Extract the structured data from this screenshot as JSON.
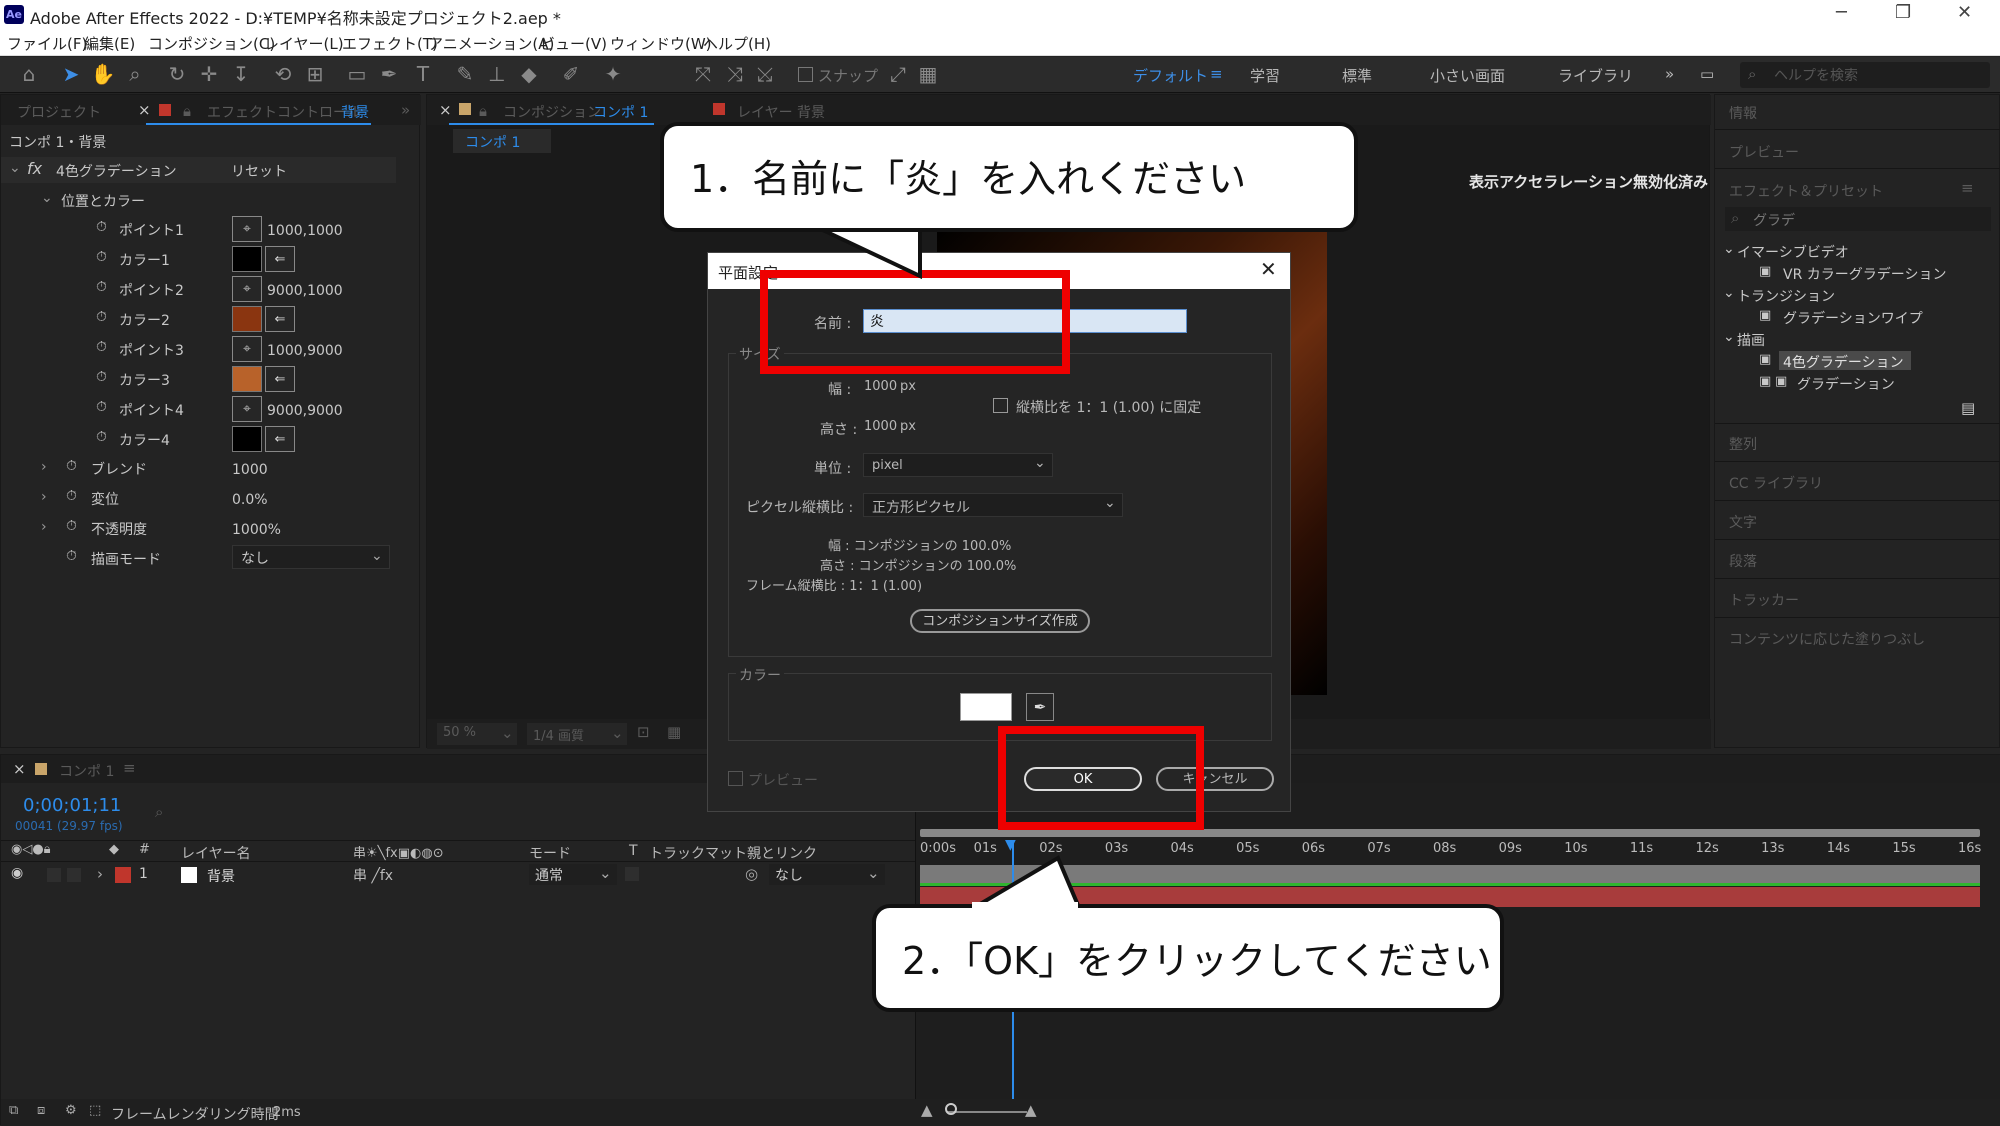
{
  "window": {
    "title": "Adobe After Effects 2022 - D:¥TEMP¥名称未設定プロジェクト2.aep *",
    "app_icon": "Ae"
  },
  "menu": [
    "ファイル(F)",
    "編集(E)",
    "コンポジション(C)",
    "レイヤー(L)",
    "エフェクト(T)",
    "アニメーション(A)",
    "ビュー(V)",
    "ウィンドウ(W)",
    "ヘルプ(H)"
  ],
  "toolbar": {
    "snap_label": "スナップ",
    "workspaces": [
      "デフォルト",
      "学習",
      "標準",
      "小さい画面",
      "ライブラリ"
    ],
    "help_search_placeholder": "ヘルプを検索"
  },
  "effects_panel": {
    "tab_project": "プロジェクト",
    "tab_effect_controls": "エフェクトコントロール",
    "tab_layer": "背景",
    "breadcrumb": "コンポ 1・背景",
    "effect_name": "4色グラデーション",
    "reset_label": "リセット",
    "group_label": "位置とカラー",
    "props": [
      {
        "label": "ポイント1",
        "value": "1000,1000"
      },
      {
        "label": "カラー1",
        "color": "#000000"
      },
      {
        "label": "ポイント2",
        "value": "9000,1000"
      },
      {
        "label": "カラー2",
        "color": "#8a3510"
      },
      {
        "label": "ポイント3",
        "value": "1000,9000"
      },
      {
        "label": "カラー3",
        "color": "#b8622a"
      },
      {
        "label": "ポイント4",
        "value": "9000,9000"
      },
      {
        "label": "カラー4",
        "color": "#000000"
      }
    ],
    "blend_label": "ブレンド",
    "blend_value": "1000",
    "jitter_label": "変位",
    "jitter_value": "0.0%",
    "opacity_label": "不透明度",
    "opacity_value": "1000%",
    "mode_label": "描画モード",
    "mode_value": "なし"
  },
  "comp_panel": {
    "tab_comp_prefix": "コンポジション",
    "tab_comp_name": "コンポ 1",
    "tab_layer": "レイヤー 背景",
    "sub_tab": "コンポ 1",
    "accel_notice": "表示アクセラレーション無効化済み",
    "zoom": "50 %",
    "resolution": "1/4 画質"
  },
  "right_panel": {
    "sections": [
      "情報",
      "プレビュー",
      "エフェクト＆プリセット"
    ],
    "search_value": "グラデ",
    "tree": [
      {
        "group": "イマーシブビデオ",
        "items": [
          "VR カラーグラデーション"
        ]
      },
      {
        "group": "トランジション",
        "items": [
          "グラデーションワイプ"
        ]
      },
      {
        "group": "描画",
        "items": [
          "4色グラデーション",
          "グラデーション"
        ]
      }
    ],
    "lower_sections": [
      "整列",
      "CC ライブラリ",
      "文字",
      "段落",
      "トラッカー",
      "コンテンツに応じた塗りつぶし"
    ]
  },
  "timeline": {
    "tab_name": "コンポ 1",
    "timecode": "0;00;01;11",
    "frames": "00041 (29.97 fps)",
    "columns": [
      "レイヤー名",
      "モード",
      "T",
      "トラックマット",
      "親とリンク"
    ],
    "layer": {
      "index": "1",
      "name": "背景",
      "mode": "通常",
      "parent": "なし"
    },
    "ruler": [
      "0:00s",
      "01s",
      "02s",
      "03s",
      "04s",
      "05s",
      "06s",
      "07s",
      "08s",
      "09s",
      "10s",
      "11s",
      "12s",
      "13s",
      "14s",
      "15s",
      "16s"
    ],
    "footer_label": "フレームレンダリング時間",
    "footer_value": "2ms"
  },
  "dialog": {
    "title": "平面設定",
    "name_label": "名前 :",
    "name_value": "炎",
    "size_group": "サイズ",
    "width_label": "幅 :",
    "width_value": "1000",
    "height_label": "高さ :",
    "height_value": "1000",
    "px": "px",
    "lock_label": "縦横比を 1：1 (1.00) に固定",
    "unit_label": "単位 :",
    "unit_value": "pixel",
    "par_label": "ピクセル縦横比 :",
    "par_value": "正方形ピクセル",
    "info_width": "幅 : コンポジションの 100.0%",
    "info_height": "高さ : コンポジションの 100.0%",
    "info_frame": "フレーム縦横比 : 1：1 (1.00)",
    "make_comp_size": "コンポジションサイズ作成",
    "color_group": "カラー",
    "preview_label": "プレビュー",
    "ok": "OK",
    "cancel": "キャンセル"
  },
  "annotations": {
    "step1": "1．名前に「炎」を入れください",
    "step2": "2．「OK」をクリックしてください"
  }
}
